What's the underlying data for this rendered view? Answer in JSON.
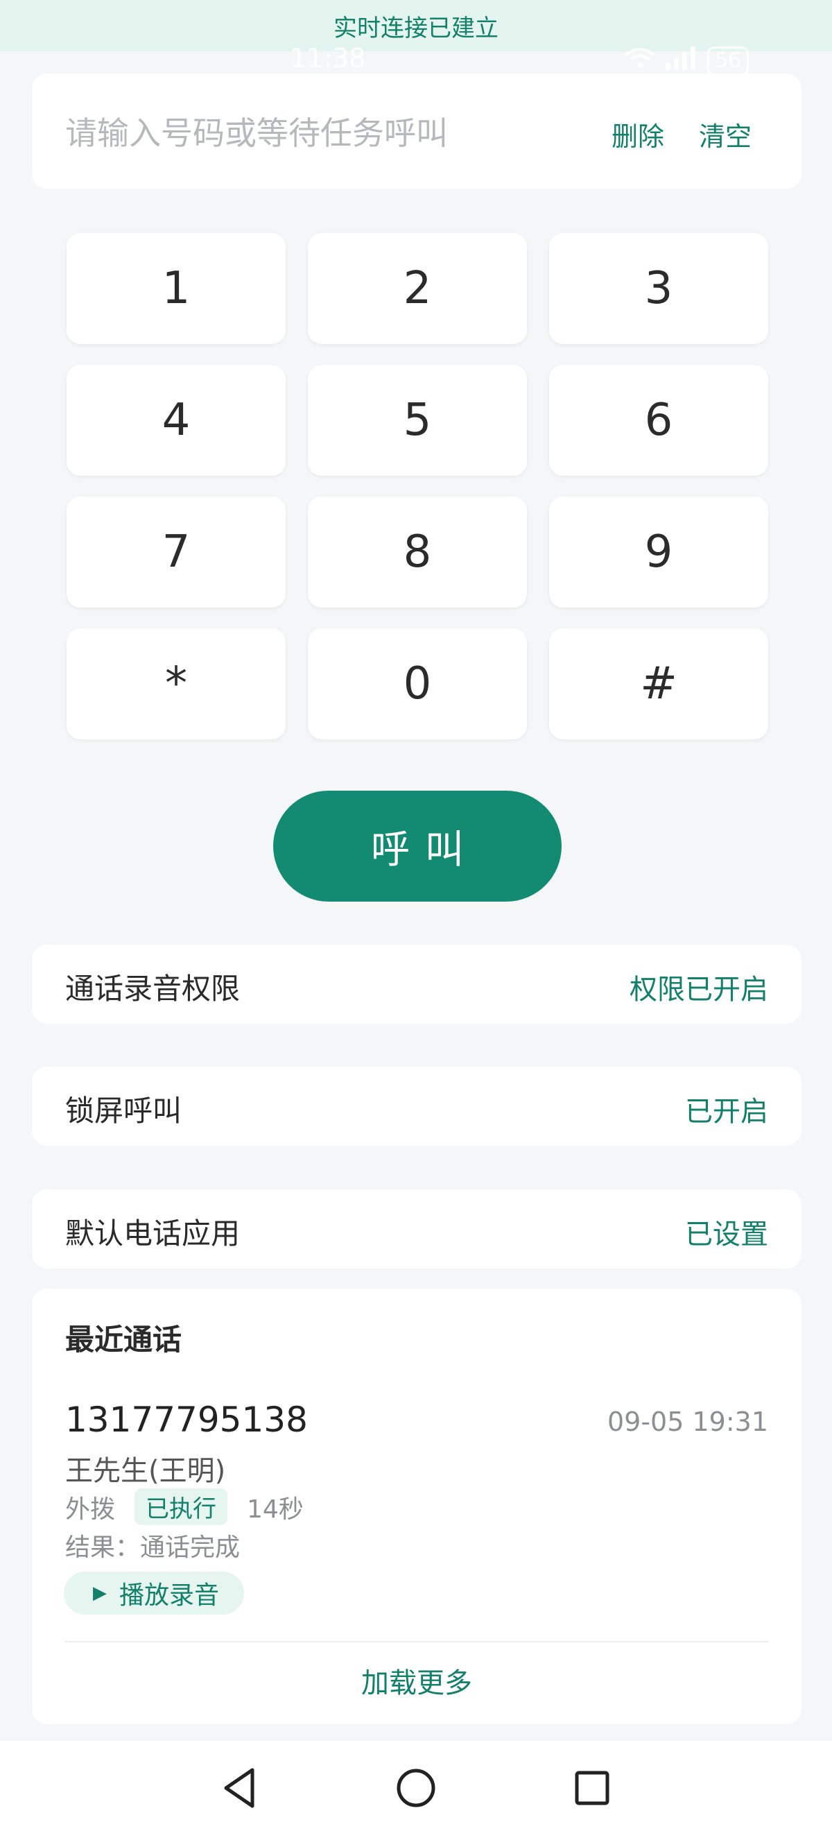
{
  "banner": {
    "text": "实时连接已建立"
  },
  "status_bar": {
    "time": "11:38",
    "battery": "56"
  },
  "dial_input": {
    "placeholder": "请输入号码或等待任务呼叫",
    "delete_label": "删除",
    "clear_label": "清空"
  },
  "keypad": {
    "keys": [
      "1",
      "2",
      "3",
      "4",
      "5",
      "6",
      "7",
      "8",
      "9",
      "*",
      "0",
      "#"
    ]
  },
  "call_button": {
    "label": "呼叫"
  },
  "settings": [
    {
      "label": "通话录音权限",
      "value": "权限已开启"
    },
    {
      "label": "锁屏呼叫",
      "value": "已开启"
    },
    {
      "label": "默认电话应用",
      "value": "已设置"
    }
  ],
  "recent_calls": {
    "title": "最近通话",
    "items": [
      {
        "number": "13177795138",
        "time": "09-05 19:31",
        "name": "王先生(王明)",
        "direction": "外拨",
        "status": "已执行",
        "duration": "14秒",
        "result": "结果：通话完成",
        "play_label": "播放录音"
      }
    ],
    "load_more": "加载更多"
  },
  "colors": {
    "accent": "#138b73",
    "accent_text": "#12806a",
    "badge_bg": "#e6f5ef",
    "background": "#f4f6f7"
  },
  "icons": {
    "play": "play-icon",
    "nav_back": "back-triangle-icon",
    "nav_home": "home-circle-icon",
    "nav_recent": "recent-square-icon"
  }
}
